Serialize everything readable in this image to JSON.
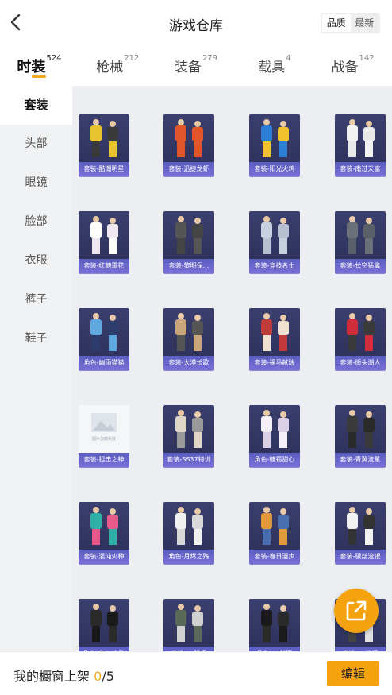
{
  "header": {
    "title": "游戏仓库",
    "sort_options": [
      "品质",
      "最新"
    ],
    "sort_selected": "品质"
  },
  "tabs": [
    {
      "label": "时装",
      "count": "524",
      "active": true
    },
    {
      "label": "枪械",
      "count": "212",
      "active": false
    },
    {
      "label": "装备",
      "count": "279",
      "active": false
    },
    {
      "label": "载具",
      "count": "4",
      "active": false
    },
    {
      "label": "战备",
      "count": "142",
      "active": false
    }
  ],
  "categories": [
    {
      "label": "套装",
      "active": true
    },
    {
      "label": "头部",
      "active": false
    },
    {
      "label": "眼镜",
      "active": false
    },
    {
      "label": "脸部",
      "active": false
    },
    {
      "label": "衣服",
      "active": false
    },
    {
      "label": "裤子",
      "active": false
    },
    {
      "label": "鞋子",
      "active": false
    }
  ],
  "items": [
    {
      "name": "套装-酷潮明星",
      "palette": [
        "#e8c530",
        "#3a3a3a"
      ],
      "empty": false
    },
    {
      "name": "套装-迅捷龙虾",
      "palette": [
        "#e0552a",
        "#e0552a"
      ],
      "empty": false
    },
    {
      "name": "套装-阳光火鸡",
      "palette": [
        "#2c7fd6",
        "#f2c12e"
      ],
      "empty": false
    },
    {
      "name": "套装-南过天富",
      "palette": [
        "#f2f2f2",
        "#e9e9e9"
      ],
      "empty": false
    },
    {
      "name": "套装-红糖霜花",
      "palette": [
        "#ffffff",
        "#f0e6f0"
      ],
      "empty": false
    },
    {
      "name": "套装-黎明保...",
      "palette": [
        "#555555",
        "#444444"
      ],
      "empty": false
    },
    {
      "name": "套装-竞技名士",
      "palette": [
        "#c8cfe0",
        "#b8bfd0"
      ],
      "empty": false
    },
    {
      "name": "套装-长空猛禽",
      "palette": [
        "#6a6f78",
        "#5a5f68"
      ],
      "empty": false
    },
    {
      "name": "角色-幽雨猫猫",
      "palette": [
        "#5fa8e0",
        "#2c3c6c"
      ],
      "empty": false
    },
    {
      "name": "套装-大漠长歌",
      "palette": [
        "#c9a67a",
        "#555555"
      ],
      "empty": false
    },
    {
      "name": "套装-福马献瑞",
      "palette": [
        "#c23b3b",
        "#f0e0d0"
      ],
      "empty": false
    },
    {
      "name": "套装-街头潮人",
      "palette": [
        "#d02c3a",
        "#3a3a3a"
      ],
      "empty": false
    },
    {
      "name": "套装-狙击之神",
      "palette": [
        "#f4f6f8",
        "#e0e4ea"
      ],
      "empty": true
    },
    {
      "name": "套装-SS37特训",
      "palette": [
        "#e0d6c8",
        "#9a9a9a"
      ],
      "empty": false
    },
    {
      "name": "角色-糖霜甜心",
      "palette": [
        "#f4eef6",
        "#dcd0e6"
      ],
      "empty": false
    },
    {
      "name": "套装-青翼流星",
      "palette": [
        "#3a3a3a",
        "#2a2a2a"
      ],
      "empty": false
    },
    {
      "name": "套装-混沌火种",
      "palette": [
        "#2fb1a8",
        "#e85a8a"
      ],
      "empty": false
    },
    {
      "name": "角色-月烬之殇",
      "palette": [
        "#f0f0f0",
        "#d8d8d8"
      ],
      "empty": false
    },
    {
      "name": "套装-春日漫步",
      "palette": [
        "#e09a3a",
        "#4a6fb0"
      ],
      "empty": false
    },
    {
      "name": "套装-骥丝流银",
      "palette": [
        "#f2f2f2",
        "#333333"
      ],
      "empty": false
    },
    {
      "name": "角色-夜... 之殇",
      "palette": [
        "#2a2a2a",
        "#1a1a1a"
      ],
      "empty": false
    },
    {
      "name": "套装-... 猎手",
      "palette": [
        "#5a6a5a",
        "#d0d0d0"
      ],
      "empty": false
    },
    {
      "name": "角色-... 魅影",
      "palette": [
        "#1a1a1a",
        "#2a2a2a"
      ],
      "empty": false
    },
    {
      "name": "套装-... 逍遥",
      "palette": [
        "#e0e0e0",
        "#444444"
      ],
      "empty": false
    }
  ],
  "empty_card_text": "图片加载失败",
  "fab": {
    "icon": "share-icon"
  },
  "bottom": {
    "shelf_label": "我的橱窗上架",
    "shelf_current": "0",
    "shelf_total": "/5",
    "edit_label": "编辑"
  },
  "colors": {
    "accent": "#f5a623",
    "card_bg": "#2c2f57",
    "card_label": "#6d66d0"
  }
}
